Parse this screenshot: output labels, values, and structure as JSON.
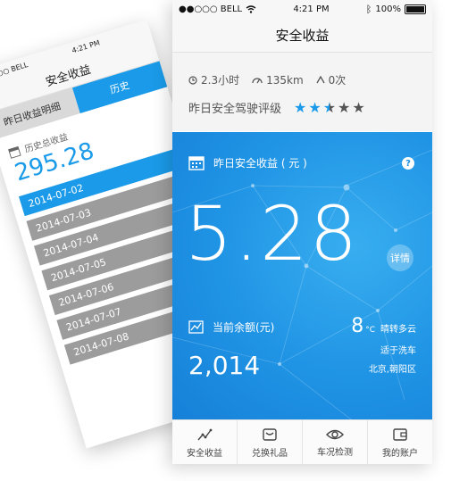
{
  "back_screen": {
    "status": {
      "carrier": "●●○○○ BELL",
      "time": "4:21 PM"
    },
    "title": "安全收益",
    "tabs": [
      {
        "label": "昨日收益明细",
        "active": false
      },
      {
        "label": "历史",
        "active": true
      }
    ],
    "total": {
      "label": "历史总收益",
      "value": "295.28"
    },
    "dates": [
      "2014-07-02",
      "2014-07-03",
      "2014-07-04",
      "2014-07-05",
      "2014-07-06",
      "2014-07-07",
      "2014-07-08"
    ],
    "selected_index": 0
  },
  "front_screen": {
    "status": {
      "carrier": "●●○○○ BELL",
      "time": "4:21 PM",
      "battery": "100%"
    },
    "title": "安全收益",
    "stats": {
      "duration": "2.3小时",
      "distance": "135km",
      "alerts": "0次"
    },
    "rating": {
      "label": "昨日安全驾驶评级",
      "stars": 2.5,
      "max": 5
    },
    "earnings": {
      "label": "昨日安全收益 ( 元 )",
      "value": "5.28",
      "help": "?",
      "detail_label": "详情"
    },
    "balance": {
      "label": "当前余额(元)",
      "value": "2,014"
    },
    "weather": {
      "temp": "8",
      "unit": "°C",
      "condition": "晴转多云",
      "advice": "适于洗车",
      "location": "北京,朝阳区"
    },
    "tabbar": [
      {
        "label": "安全收益",
        "icon": "trend-icon"
      },
      {
        "label": "兑换礼品",
        "icon": "gift-icon"
      },
      {
        "label": "车况检测",
        "icon": "eye-icon"
      },
      {
        "label": "我的账户",
        "icon": "wallet-icon"
      }
    ],
    "colors": {
      "accent": "#1f93e4",
      "star_on": "#1a9ae8",
      "star_off": "#555555"
    }
  }
}
